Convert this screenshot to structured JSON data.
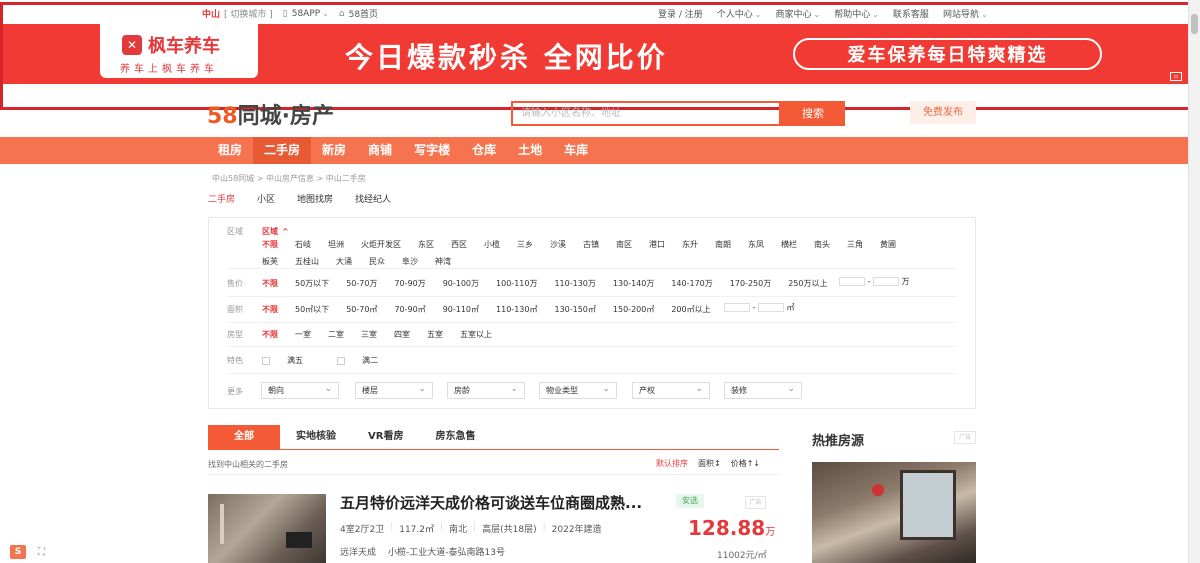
{
  "topbar": {
    "city": "中山",
    "switch_city": "[ 切换城市 ]",
    "app": "58APP",
    "home": "58首页",
    "login": "登录 / 注册",
    "links": [
      "个人中心",
      "商家中心",
      "帮助中心",
      "联系客服",
      "网站导航"
    ]
  },
  "ad": {
    "brand": "枫车养车",
    "brand_sub": "养车上枫车养车",
    "headline": "今日爆款秒杀 全网比价",
    "pill": "爱车保养每日特爽精选",
    "tag": "广告"
  },
  "header": {
    "logo_num": "58",
    "logo_text": "同城·房产",
    "search_placeholder": "请输入小区名称、地址",
    "search_button": "搜索",
    "publish_button": "免费发布"
  },
  "nav": [
    "租房",
    "二手房",
    "新房",
    "商铺",
    "写字楼",
    "仓库",
    "土地",
    "车库"
  ],
  "breadcrumb": "中山58同城 > 中山房产信息 > 中山二手房",
  "subtabs": [
    "二手房",
    "小区",
    "地图找房",
    "找经纪人"
  ],
  "filters": {
    "district_label": "区域",
    "district_toggle": "区域",
    "districts": [
      "不限",
      "石岐",
      "坦洲",
      "火炬开发区",
      "东区",
      "西区",
      "小榄",
      "三乡",
      "沙溪",
      "古镇",
      "南区",
      "港口",
      "东升",
      "南朗",
      "东凤",
      "横栏",
      "南头",
      "三角",
      "黄圃",
      "板芙",
      "五桂山",
      "大涌",
      "民众",
      "阜沙",
      "神湾"
    ],
    "price_label": "售价",
    "prices": [
      "不限",
      "50万以下",
      "50-70万",
      "70-90万",
      "90-100万",
      "100-110万",
      "110-130万",
      "130-140万",
      "140-170万",
      "170-250万",
      "250万以上"
    ],
    "price_unit": "万",
    "area_label": "面积",
    "areas": [
      "不限",
      "50㎡以下",
      "50-70㎡",
      "70-90㎡",
      "90-110㎡",
      "110-130㎡",
      "130-150㎡",
      "150-200㎡",
      "200㎡以上"
    ],
    "area_unit": "㎡",
    "layout_label": "房型",
    "layouts": [
      "不限",
      "一室",
      "二室",
      "三室",
      "四室",
      "五室",
      "五室以上"
    ],
    "feature_label": "特色",
    "features": [
      "满五",
      "满二"
    ],
    "more_label": "更多",
    "more": [
      "朝向",
      "楼层",
      "房龄",
      "物业类型",
      "产权",
      "装修"
    ]
  },
  "listing_tabs": [
    "全部",
    "实地核验",
    "VR看房",
    "房东急售"
  ],
  "found_text": "找到中山相关的二手房",
  "sorts": [
    "默认排序",
    "面积↕",
    "价格↑↓"
  ],
  "listing": {
    "title": "五月特价远洋天成价格可谈送车位商圈成熟...",
    "badge": "安选",
    "ad_tag": "广告",
    "attrs": [
      "4室2厅2卫",
      "117.2㎡",
      "南北",
      "高层(共18层)",
      "2022年建造"
    ],
    "community": "远洋天成",
    "address": "小榄-工业大道-泰弘南路13号",
    "price": "128.88",
    "price_unit": "万",
    "unit_price": "11002元/㎡"
  },
  "hot": {
    "title": "热推房源",
    "ad_tag": "广告"
  },
  "colors": {
    "accent": "#f35b37",
    "price": "#e4393c",
    "ad_bg": "#f03a33"
  }
}
